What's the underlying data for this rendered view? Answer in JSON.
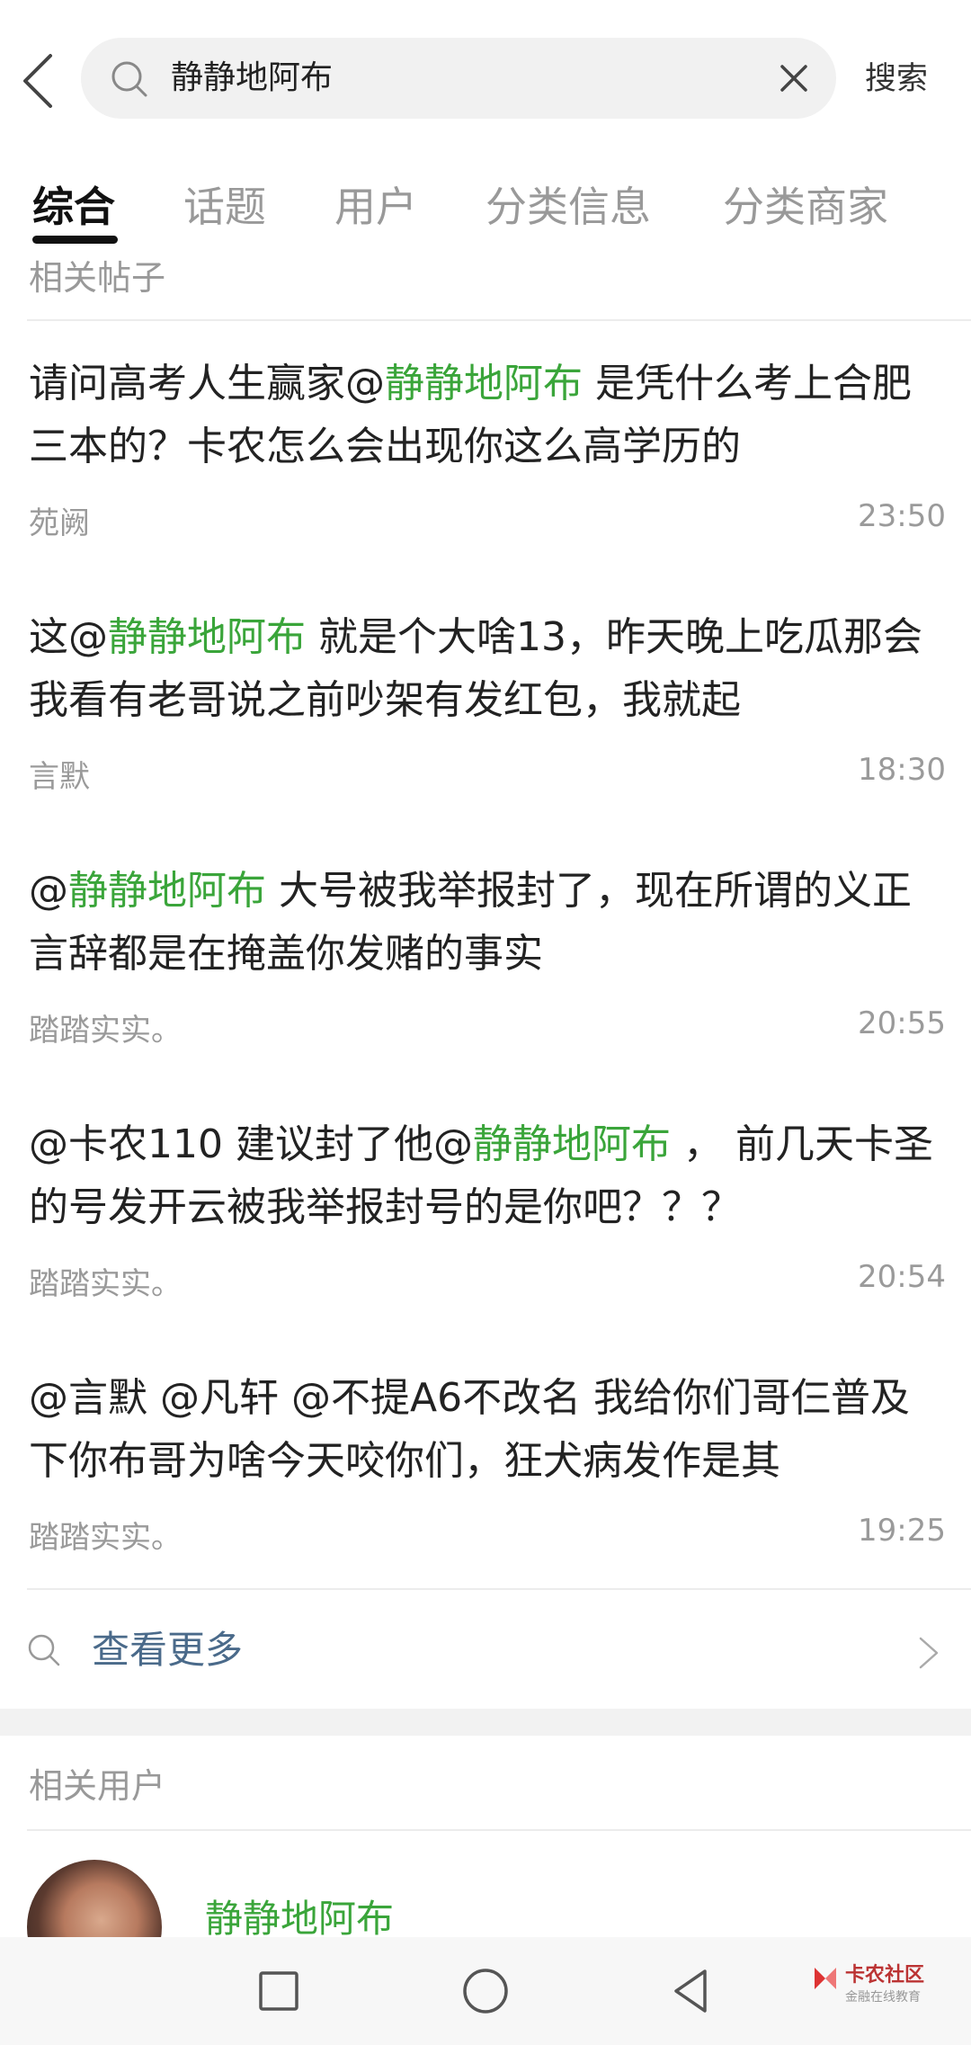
{
  "header": {
    "search_query": "静静地阿布",
    "search_action": "搜索"
  },
  "tabs": [
    {
      "label": "综合",
      "active": true
    },
    {
      "label": "话题",
      "active": false
    },
    {
      "label": "用户",
      "active": false
    },
    {
      "label": "分类信息",
      "active": false
    },
    {
      "label": "分类商家",
      "active": false
    }
  ],
  "posts_section": {
    "label": "相关帖子",
    "posts": [
      {
        "parts": [
          "请问高考人生赢家@",
          "静静地阿布",
          " 是凭什么考上合肥三本的？卡农怎么会出现你这么高学历的"
        ],
        "author": "苑阙",
        "time": "23:50"
      },
      {
        "parts": [
          "这@",
          "静静地阿布",
          " 就是个大啥13，昨天晚上吃瓜那会我看有老哥说之前吵架有发红包，我就起"
        ],
        "author": "言默",
        "time": "18:30"
      },
      {
        "parts": [
          "@",
          "静静地阿布",
          " 大号被我举报封了，现在所谓的义正言辞都是在掩盖你发赌的事实"
        ],
        "author": "踏踏实实。",
        "time": "20:55"
      },
      {
        "parts": [
          "@卡农110 建议封了他@",
          "静静地阿布",
          " ， 前几天卡圣的号发开云被我举报封号的是你吧？？？"
        ],
        "author": "踏踏实实。",
        "time": "20:54"
      },
      {
        "parts": [
          "@言默 @凡轩 @不提A6不改名 我给你们哥仨普及下你布哥为啥今天咬你们，狂犬病发作是其",
          "",
          ""
        ],
        "author": "踏踏实实。",
        "time": "19:25"
      }
    ],
    "more_label": "查看更多"
  },
  "users_section": {
    "label": "相关用户",
    "users": [
      {
        "name": "静静地阿布"
      }
    ]
  },
  "watermark": {
    "title": "卡农社区",
    "subtitle": "金融在线教育"
  },
  "colors": {
    "highlight": "#3aa53a",
    "more_link": "#4a6a8a"
  }
}
